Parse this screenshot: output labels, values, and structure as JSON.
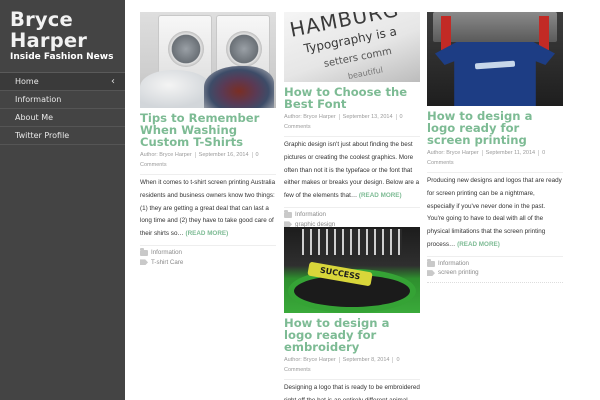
{
  "site": {
    "title": "Bryce Harper",
    "tagline": "Inside Fashion News"
  },
  "nav": {
    "items": [
      {
        "label": "Home",
        "active": true,
        "icon": "chevron-left-icon"
      },
      {
        "label": "Information"
      },
      {
        "label": "About Me"
      },
      {
        "label": "Twitter Profile"
      }
    ],
    "chevron": "‹"
  },
  "colors": {
    "sidebar_bg": "#444444",
    "accent_green": "#7dbb94",
    "text": "#333333",
    "meta_gray": "#9a9a9a"
  },
  "posts": [
    {
      "title": "Tips to Remember When Washing Custom T-Shirts",
      "author": "Author: Bryce Harper",
      "date": "September 16, 2014",
      "comments": "0 Comments",
      "excerpt": "When it comes to t-shirt screen printing Australia residents and business owners know two things: (1) they are getting a great deal that can last a long time and (2) they have to take good care of their shirts so…",
      "read_more": "(READ MORE)",
      "category": "Information",
      "tag": "T-shirt Care",
      "image": "washing-machines-laundry"
    },
    {
      "title": "How to Choose the Best Font",
      "author": "Author: Bryce Harper",
      "date": "September 13, 2014",
      "comments": "0 Comments",
      "excerpt": "Graphic design isn't just about finding the best pictures or creating the coolest graphics. More often than not it is the typeface or the font that either makes or breaks your design. Below are a few of the elements that…",
      "read_more": "(READ MORE)",
      "category": "Information",
      "tag": "graphic design",
      "image": "typography-specimen",
      "image_words": [
        "HAMBURG",
        "Typography is a",
        "setters comm",
        "beautiful"
      ]
    },
    {
      "title": "How to design a logo ready for screen printing",
      "author": "Author: Bryce Harper",
      "date": "September 11, 2014",
      "comments": "0 Comments",
      "excerpt": "Producing new designs and logos that are ready for screen printing can be a nightmare, especially if you've never done in the past. You're going to have to deal with all of the physical limitations that the screen printing process…",
      "read_more": "(READ MORE)",
      "category": "Information",
      "tag": "screen printing",
      "image": "screen-printing-press-shirt"
    },
    {
      "title": "How to design a logo ready for embroidery",
      "author": "Author: Bryce Harper",
      "date": "September 8, 2014",
      "comments": "0 Comments",
      "excerpt": "Designing a logo that is ready to be embroidered right off the bat is an entirely different animal than trying to digitize a logo for",
      "image": "embroidery-machine",
      "image_word": "SUCCESS"
    }
  ]
}
